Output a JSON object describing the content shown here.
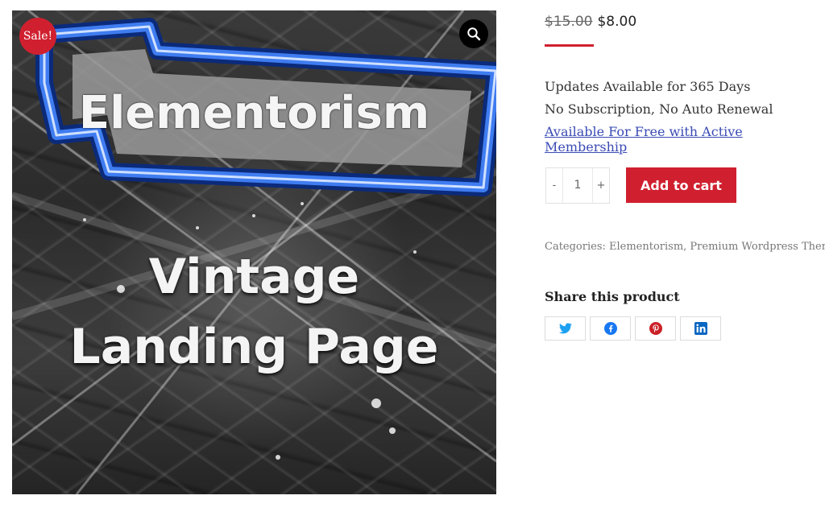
{
  "product_image": {
    "brand_text": "Elementorism",
    "title_line1": "Vintage",
    "title_line2": "Landing Page"
  },
  "sale_badge": "Sale!",
  "price": {
    "old": "$15.00",
    "new": "$8.00"
  },
  "info": {
    "updates": "Updates Available for 365 Days",
    "subscription": "No Subscription, No Auto Renewal",
    "membership_link": "Available For Free with Active Membership"
  },
  "quantity": {
    "minus": "-",
    "value": "1",
    "plus": "+"
  },
  "add_to_cart": "Add to cart",
  "categories": "Categories: Elementorism, Premium Wordpress Themes",
  "share": {
    "title": "Share this product",
    "buttons": [
      "twitter-icon",
      "facebook-icon",
      "pinterest-icon",
      "linkedin-icon"
    ]
  },
  "colors": {
    "accent": "#d0202f",
    "link": "#3a4bb5",
    "twitter": "#1da1f2",
    "facebook": "#1877f2",
    "pinterest": "#cb2027",
    "linkedin": "#0a66c2"
  }
}
